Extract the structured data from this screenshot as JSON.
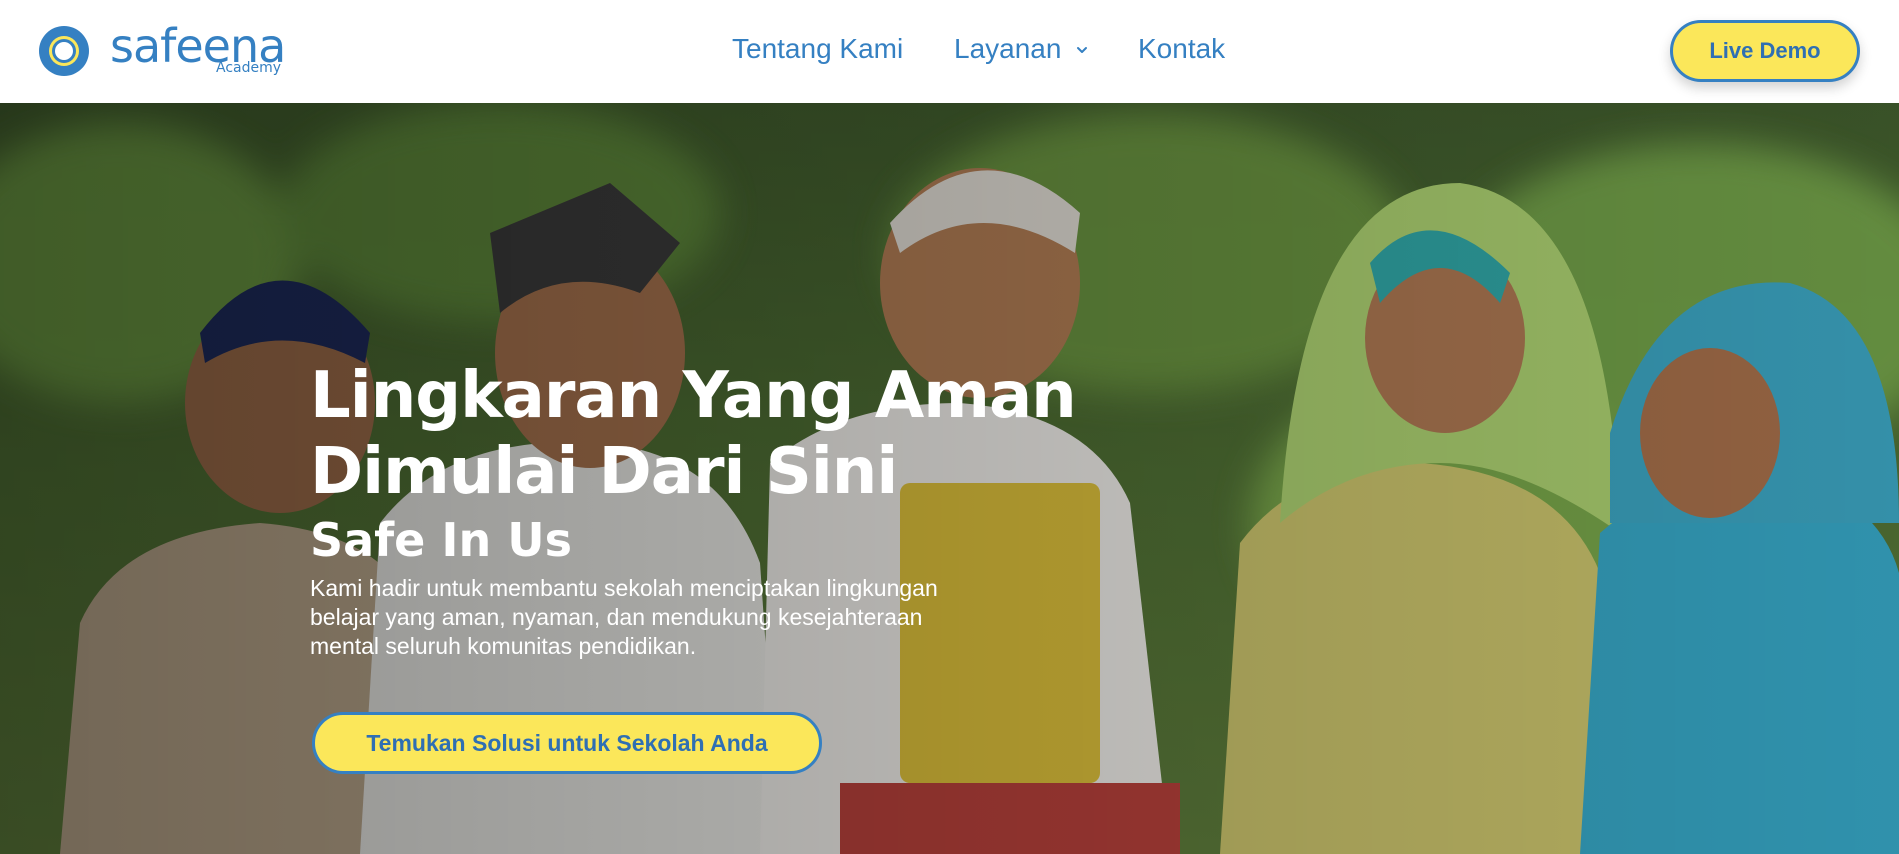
{
  "brand": {
    "name": "safeena",
    "sub": "Academy",
    "colors": {
      "primary": "#3580c2",
      "accent": "#fbe75a"
    }
  },
  "nav": {
    "items": [
      {
        "label": "Tentang Kami"
      },
      {
        "label": "Layanan",
        "icon": "chevron-down-icon"
      },
      {
        "label": "Kontak"
      }
    ],
    "cta_label": "Live Demo"
  },
  "hero": {
    "title": "Lingkaran Yang Aman Dimulai Dari Sini",
    "subtitle": "Safe In Us",
    "description": "Kami hadir untuk membantu sekolah menciptakan lingkungan belajar yang aman, nyaman, dan mendukung kesejahteraan mental seluruh komunitas pendidikan.",
    "cta_label": "Temukan Solusi untuk Sekolah Anda"
  }
}
